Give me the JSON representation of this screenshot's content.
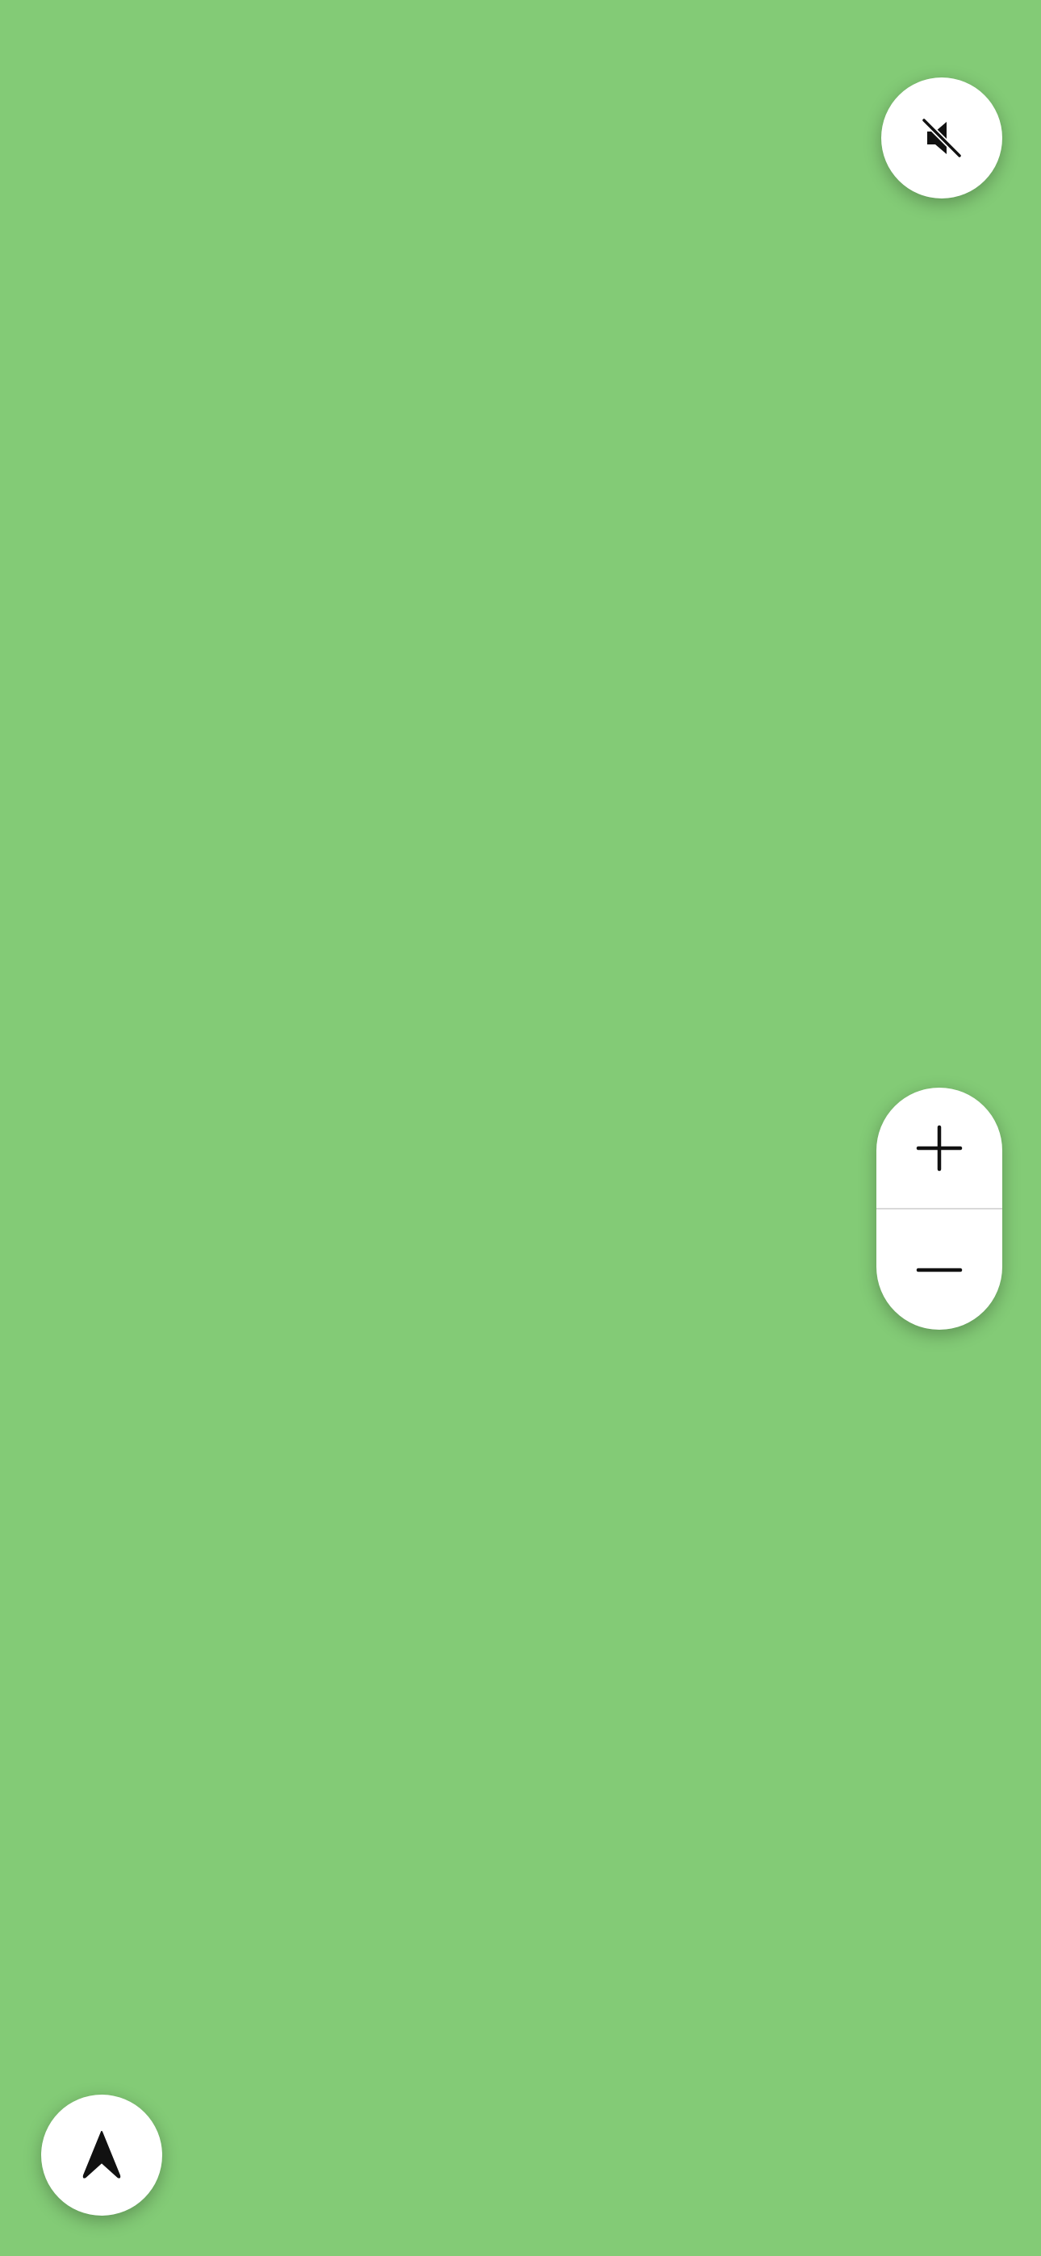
{
  "map": {
    "background_color": "#83cb76"
  },
  "controls": {
    "mute": {
      "icon": "speaker-muted-icon"
    },
    "zoom_in": {
      "icon": "plus-icon"
    },
    "zoom_out": {
      "icon": "minus-icon"
    },
    "recenter": {
      "icon": "navigation-arrow-icon"
    }
  }
}
